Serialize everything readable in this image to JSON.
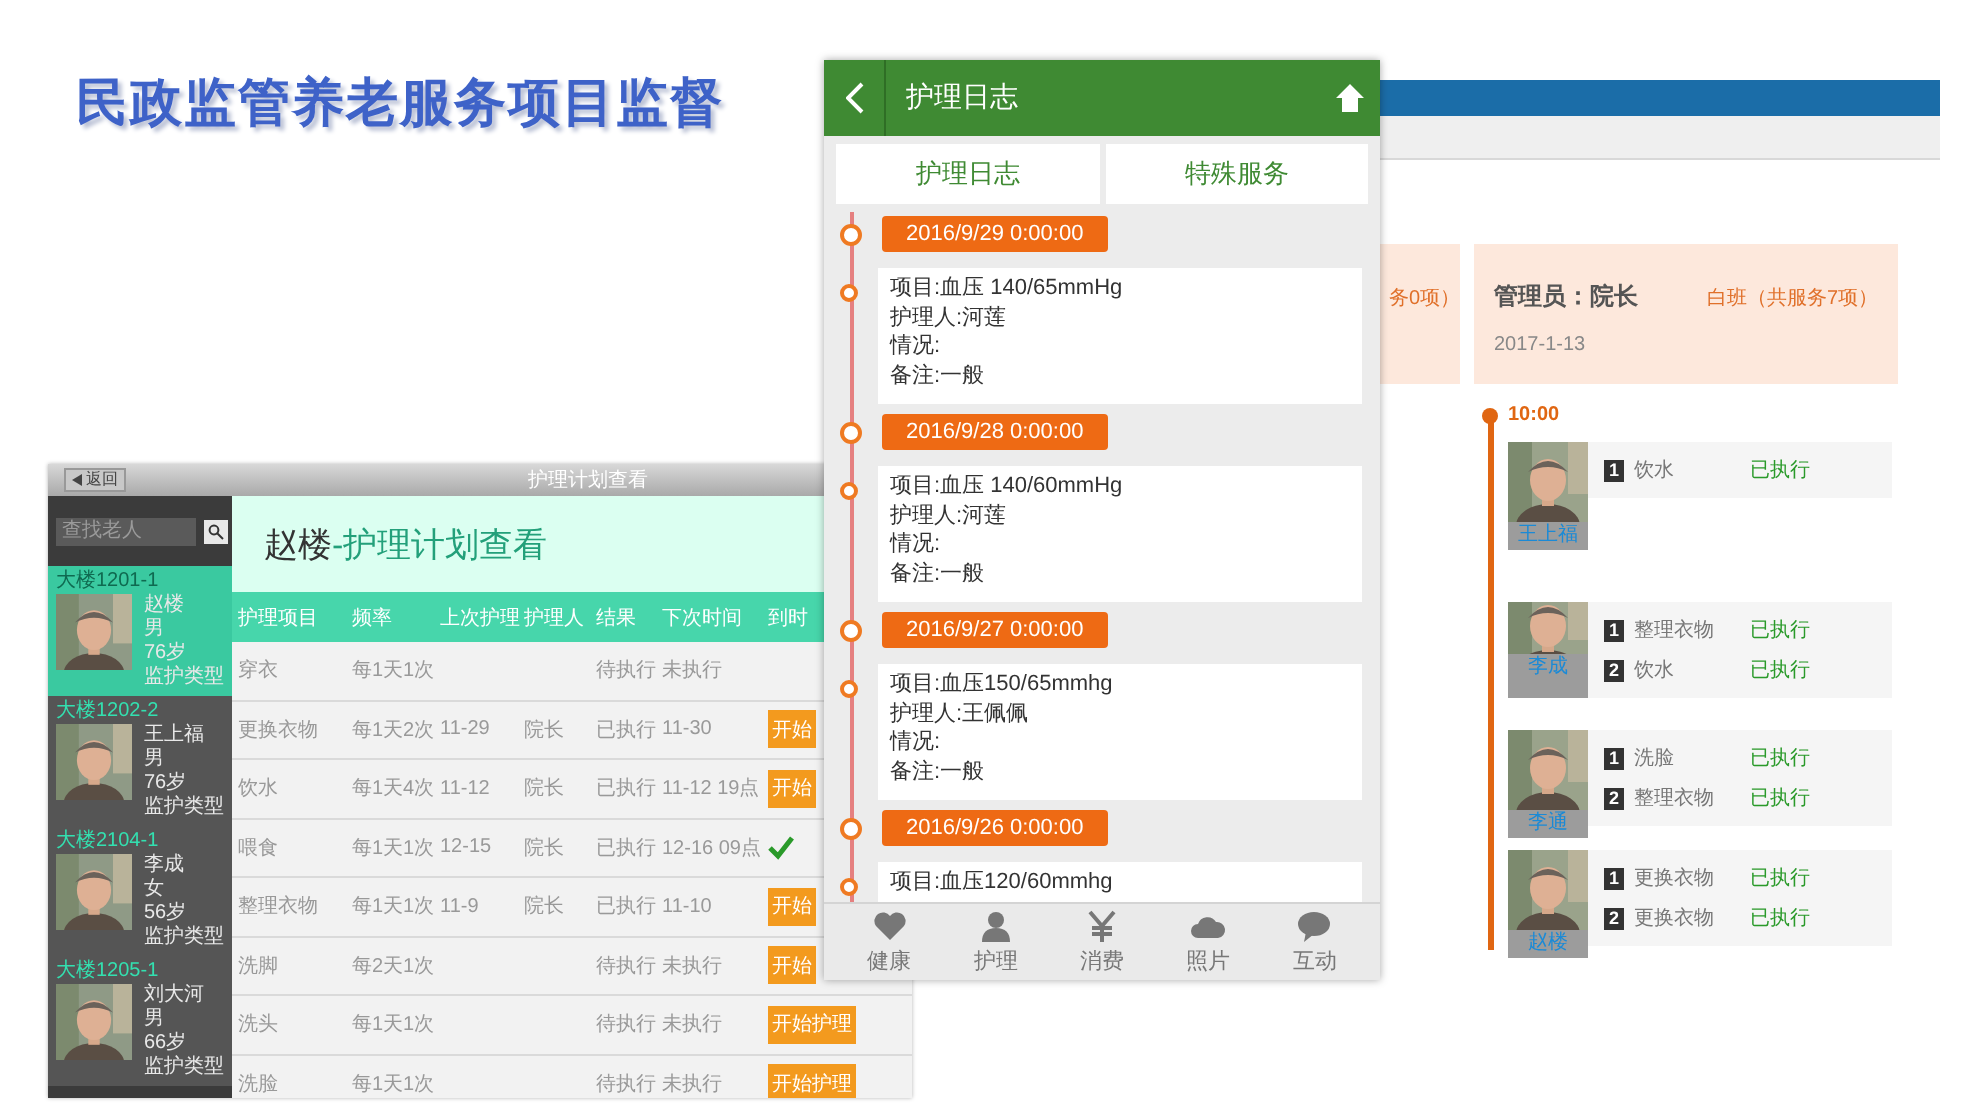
{
  "slide": {
    "title": "民政监管养老服务项目监督"
  },
  "dash": {
    "partial_card": {
      "shift_summary": "务0项）"
    },
    "card": {
      "admin": "管理员：院长",
      "shift_summary": "白班（共服务7项）",
      "date": "2017-1-13"
    },
    "timeline": {
      "time": "10:00",
      "groups": [
        {
          "name": "王上福",
          "tasks": [
            {
              "no": "1",
              "task": "饮水",
              "status": "已执行"
            }
          ]
        },
        {
          "name": "李成",
          "tasks": [
            {
              "no": "1",
              "task": "整理衣物",
              "status": "已执行"
            },
            {
              "no": "2",
              "task": "饮水",
              "status": "已执行"
            }
          ]
        },
        {
          "name": "李通",
          "tasks": [
            {
              "no": "1",
              "task": "洗脸",
              "status": "已执行"
            },
            {
              "no": "2",
              "task": "整理衣物",
              "status": "已执行"
            }
          ]
        },
        {
          "name": "赵楼",
          "tasks": [
            {
              "no": "1",
              "task": "更换衣物",
              "status": "已执行"
            },
            {
              "no": "2",
              "task": "更换衣物",
              "status": "已执行"
            }
          ]
        }
      ]
    }
  },
  "tablet": {
    "back": "返回",
    "title": "护理计划查看",
    "search": {
      "placeholder": "查找老人"
    },
    "residents": [
      {
        "room": "大楼1201-1",
        "name": "赵楼",
        "gender": "男",
        "age": "76岁",
        "type": "监护类型",
        "selected": true
      },
      {
        "room": "大楼1202-2",
        "name": "王上福",
        "gender": "男",
        "age": "76岁",
        "type": "监护类型",
        "selected": false
      },
      {
        "room": "大楼2104-1",
        "name": "李成",
        "gender": "女",
        "age": "56岁",
        "type": "监护类型",
        "selected": false
      },
      {
        "room": "大楼1205-1",
        "name": "刘大河",
        "gender": "男",
        "age": "66岁",
        "type": "监护类型",
        "selected": false
      }
    ],
    "header": {
      "name": "赵楼",
      "title": "-护理计划查看"
    },
    "table": {
      "columns": [
        "护理项目",
        "频率",
        "上次护理",
        "护理人",
        "结果",
        "下次时间",
        "到时"
      ],
      "rows": [
        {
          "item": "穿衣",
          "freq": "每1天1次",
          "result": "待执行",
          "next": "未执行"
        },
        {
          "item": "更换衣物",
          "freq": "每1天2次",
          "last": "11-29",
          "nurse": "院长",
          "result": "已执行",
          "next": "11-30",
          "action": {
            "kind": "button",
            "label": "开始"
          }
        },
        {
          "item": "饮水",
          "freq": "每1天4次",
          "last": "11-12",
          "nurse": "院长",
          "result": "已执行",
          "next": "11-12 19点",
          "action": {
            "kind": "button",
            "label": "开始"
          }
        },
        {
          "item": "喂食",
          "freq": "每1天1次",
          "last": "12-15",
          "nurse": "院长",
          "result": "已执行",
          "next": "12-16 09点",
          "action": {
            "kind": "check"
          }
        },
        {
          "item": "整理衣物",
          "freq": "每1天1次",
          "last": "11-9",
          "nurse": "院长",
          "result": "已执行",
          "next": "11-10",
          "action": {
            "kind": "button",
            "label": "开始"
          }
        },
        {
          "item": "洗脚",
          "freq": "每2天1次",
          "result": "待执行",
          "next": "未执行",
          "action": {
            "kind": "button",
            "label": "开始"
          }
        },
        {
          "item": "洗头",
          "freq": "每1天1次",
          "result": "待执行",
          "next": "未执行",
          "action": {
            "kind": "button",
            "label": "开始护理"
          }
        },
        {
          "item": "洗脸",
          "freq": "每1天1次",
          "result": "待执行",
          "next": "未执行",
          "action": {
            "kind": "button",
            "label": "开始护理"
          }
        }
      ]
    }
  },
  "phone": {
    "title": "护理日志",
    "tabs": [
      "护理日志",
      "特殊服务"
    ],
    "entries": [
      {
        "date": "2016/9/29 0:00:00",
        "lines": [
          "项目:血压 140/65mmHg",
          "护理人:河莲",
          "情况:",
          "备注:一般"
        ]
      },
      {
        "date": "2016/9/28 0:00:00",
        "lines": [
          "项目:血压 140/60mmHg",
          "护理人:河莲",
          "情况:",
          "备注:一般"
        ]
      },
      {
        "date": "2016/9/27 0:00:00",
        "lines": [
          "项目:血压150/65mmhg",
          "护理人:王佩佩",
          "情况:",
          "备注:一般"
        ]
      },
      {
        "date": "2016/9/26 0:00:00",
        "lines": [
          "项目:血压120/60mmhg"
        ]
      }
    ],
    "tabbar": [
      {
        "kind": "heart",
        "label": "健康"
      },
      {
        "kind": "person",
        "label": "护理"
      },
      {
        "kind": "yen",
        "label": "消费"
      },
      {
        "kind": "cloud",
        "label": "照片"
      },
      {
        "kind": "chat",
        "label": "互动"
      }
    ]
  }
}
